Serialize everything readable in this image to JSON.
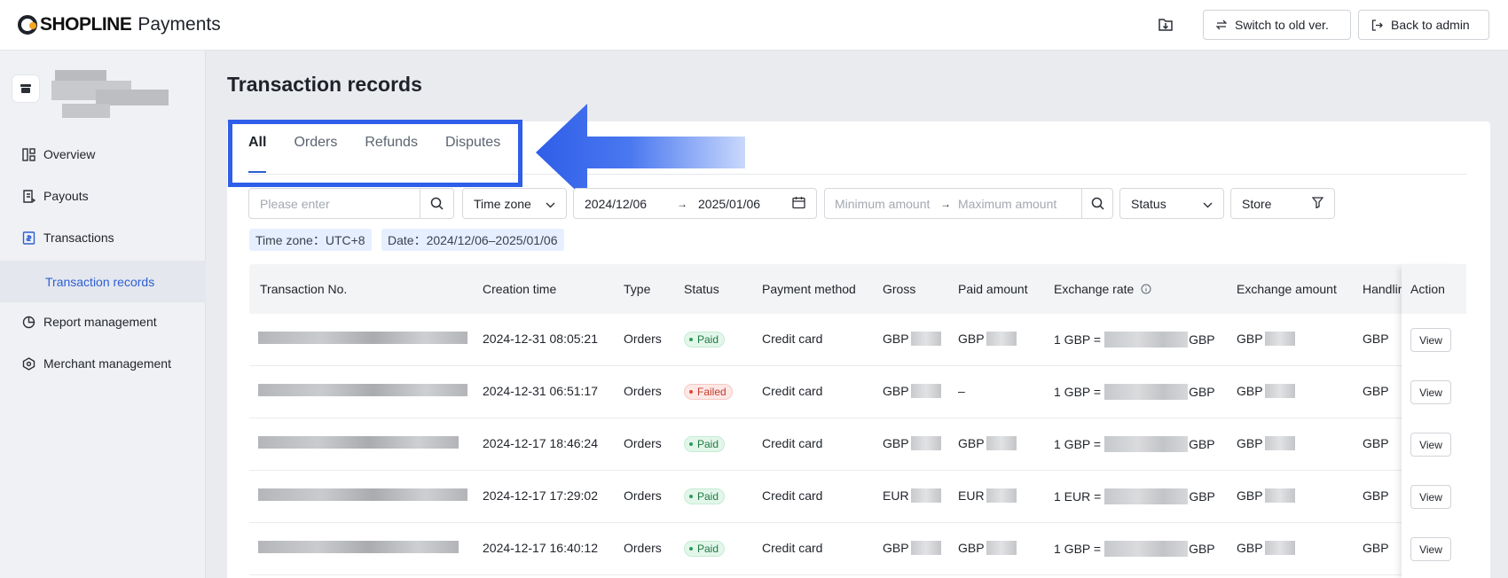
{
  "topbar": {
    "brand": "SHOPLINE",
    "product": "Payments",
    "switch_label": "Switch to old ver.",
    "admin_label": "Back to admin"
  },
  "sidebar": {
    "items": [
      {
        "label": "Overview",
        "icon": "overview-icon"
      },
      {
        "label": "Payouts",
        "icon": "payouts-icon"
      },
      {
        "label": "Transactions",
        "icon": "transactions-icon"
      },
      {
        "label": "Report management",
        "icon": "report-icon"
      },
      {
        "label": "Merchant management",
        "icon": "merchant-icon"
      }
    ],
    "active_sub": "Transaction records"
  },
  "page": {
    "title": "Transaction records"
  },
  "tabs": [
    {
      "label": "All",
      "active": true
    },
    {
      "label": "Orders",
      "active": false
    },
    {
      "label": "Refunds",
      "active": false
    },
    {
      "label": "Disputes",
      "active": false
    }
  ],
  "filters": {
    "search_placeholder": "Please enter",
    "timezone_label": "Time zone",
    "date_start": "2024/12/06",
    "date_end": "2025/01/06",
    "amount_min_placeholder": "Minimum amount",
    "amount_max_placeholder": "Maximum amount",
    "status_label": "Status",
    "store_label": "Store"
  },
  "chips": {
    "timezone": "Time zone：UTC+8",
    "date": "Date：2024/12/06–2025/01/06"
  },
  "table": {
    "columns": [
      "Transaction No.",
      "Creation time",
      "Type",
      "Status",
      "Payment method",
      "Gross",
      "Paid amount",
      "Exchange rate",
      "Exchange amount",
      "Handlin",
      "Action"
    ],
    "view_label": "View",
    "rows": [
      {
        "time": "2024-12-31 08:05:21",
        "type": "Orders",
        "status": "Paid",
        "method": "Credit card",
        "gross_cur": "GBP",
        "paid_cur": "GBP",
        "rate_prefix": "1 GBP =",
        "rate_suffix": "GBP",
        "exch_cur": "GBP",
        "handling_cur": "GBP"
      },
      {
        "time": "2024-12-31 06:51:17",
        "type": "Orders",
        "status": "Failed",
        "method": "Credit card",
        "gross_cur": "GBP",
        "paid_cur": "–",
        "rate_prefix": "1 GBP =",
        "rate_suffix": "GBP",
        "exch_cur": "GBP",
        "handling_cur": "GBP"
      },
      {
        "time": "2024-12-17 18:46:24",
        "type": "Orders",
        "status": "Paid",
        "method": "Credit card",
        "gross_cur": "GBP",
        "paid_cur": "GBP",
        "rate_prefix": "1 GBP =",
        "rate_suffix": "GBP",
        "exch_cur": "GBP",
        "handling_cur": "GBP"
      },
      {
        "time": "2024-12-17 17:29:02",
        "type": "Orders",
        "status": "Paid",
        "method": "Credit card",
        "gross_cur": "EUR",
        "paid_cur": "EUR",
        "rate_prefix": "1 EUR =",
        "rate_suffix": "GBP",
        "exch_cur": "GBP",
        "handling_cur": "GBP"
      },
      {
        "time": "2024-12-17 16:40:12",
        "type": "Orders",
        "status": "Paid",
        "method": "Credit card",
        "gross_cur": "GBP",
        "paid_cur": "GBP",
        "rate_prefix": "1 GBP =",
        "rate_suffix": "GBP",
        "exch_cur": "GBP",
        "handling_cur": "GBP"
      }
    ]
  },
  "colors": {
    "accent": "#2d5fd3",
    "highlight": "#2f5ee8"
  }
}
